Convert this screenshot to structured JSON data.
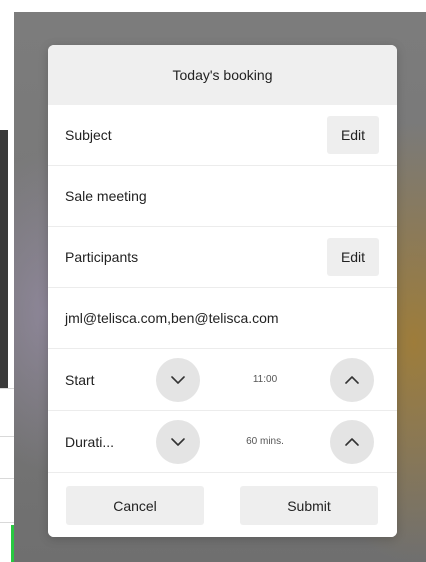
{
  "dialog": {
    "title": "Today's booking",
    "subject": {
      "label": "Subject",
      "edit_label": "Edit",
      "value": "Sale meeting"
    },
    "participants": {
      "label": "Participants",
      "edit_label": "Edit",
      "value": "jml@telisca.com,ben@telisca.com"
    },
    "start": {
      "label": "Start",
      "value": "11:00",
      "down_icon": "chevron-down-icon",
      "up_icon": "chevron-up-icon"
    },
    "duration": {
      "label": "Durati...",
      "value": "60 mins.",
      "down_icon": "chevron-down-icon",
      "up_icon": "chevron-up-icon"
    },
    "cancel_label": "Cancel",
    "submit_label": "Submit"
  },
  "colors": {
    "header_bg": "#efefef",
    "button_bg": "#eeeeee",
    "round_button_bg": "#e4e4e4",
    "status_green": "#28c840"
  }
}
